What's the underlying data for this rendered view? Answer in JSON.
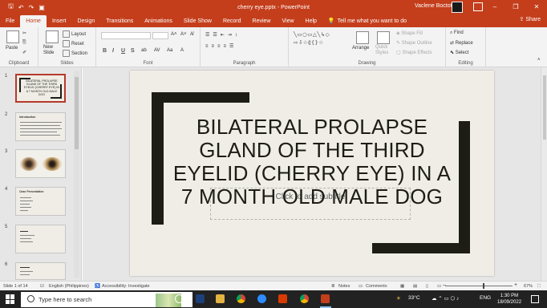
{
  "titlebar": {
    "document_title": "cherry eye.pptx  -  PowerPoint",
    "user_name": "Vaclene Boctot",
    "quick_access": [
      "save-icon",
      "undo-icon",
      "redo-icon",
      "present-icon"
    ]
  },
  "tabs": [
    "File",
    "Home",
    "Insert",
    "Design",
    "Transitions",
    "Animations",
    "Slide Show",
    "Record",
    "Review",
    "View",
    "Help"
  ],
  "active_tab": "Home",
  "tell_me": "Tell me what you want to do",
  "share_label": "Share",
  "ribbon": {
    "clipboard": {
      "paste": "Paste",
      "label": "Clipboard"
    },
    "slides": {
      "new_slide": "New Slide",
      "layout": "Layout",
      "reset": "Reset",
      "section": "Section",
      "label": "Slides"
    },
    "font": {
      "label": "Font",
      "bold": "B",
      "italic": "I",
      "underline": "U",
      "strike": "S"
    },
    "paragraph": {
      "label": "Paragraph"
    },
    "drawing": {
      "arrange": "Arrange",
      "quick_styles": "Quick Styles",
      "shape_fill": "Shape Fill",
      "shape_outline": "Shape Outline",
      "shape_effects": "Shape Effects",
      "label": "Drawing"
    },
    "editing": {
      "find": "Find",
      "replace": "Replace",
      "select": "Select",
      "label": "Editing"
    }
  },
  "slides_panel": [
    {
      "num": "1",
      "title": "BILATERAL PROLAPSE GLAND OF THE THIRD EYELID (CHERRY EYE) IN A 7 MONTH OLD MALE DOG",
      "selected": true
    },
    {
      "num": "2",
      "title": "Introduction"
    },
    {
      "num": "3",
      "title": ""
    },
    {
      "num": "4",
      "title": "Case Presentation"
    },
    {
      "num": "5",
      "title": ""
    },
    {
      "num": "6",
      "title": ""
    }
  ],
  "slide": {
    "title": "BILATERAL PROLAPSE GLAND OF THE THIRD EYELID (CHERRY EYE) IN A 7 MONTH OLD MALE DOG",
    "subtitle_placeholder": "Click to add subtitle"
  },
  "statusbar": {
    "slide_info": "Slide 1 of 14",
    "language": "English (Philippines)",
    "accessibility": "Accessibility: Investigate",
    "notes": "Notes",
    "comments": "Comments",
    "zoom": "67%"
  },
  "taskbar": {
    "search_placeholder": "Type here to search",
    "weather": "33°C",
    "language": "ENG",
    "time": "1:30 PM",
    "date": "18/09/2022"
  }
}
